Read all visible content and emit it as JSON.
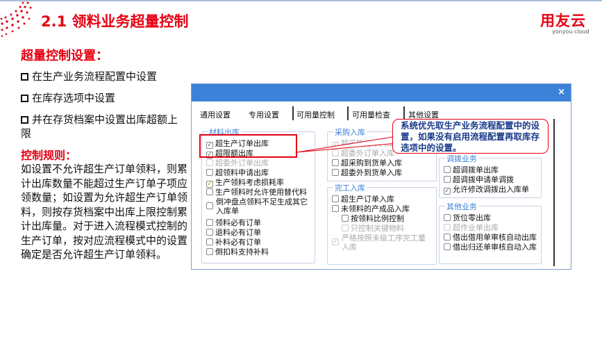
{
  "slide": {
    "title": "2.1 领料业务超量控制",
    "logo": "用友云",
    "logo_sub": "yonyou cloud",
    "accent": "#e60012",
    "setting_heading": "超量控制设置：",
    "setting_items": [
      "在生产业务流程配置中设置",
      "在库存选项中设置",
      "并在存货档案中设置出库超额上限"
    ],
    "rule_heading": "控制规则：",
    "rule_text": "如设置不允许超生产订单领料，则累计出库数量不能超过生产订单子项应领数量；如设置为允许超生产订单领料，则按存货档案中出库上限控制累计出库量。对于进入流程模式控制的生产订单，按对应流程模式中的设置确定是否允许超生产订单领料。",
    "callout": "系统优先取生产业务流程配置中的设置，如果没有启用流程配置再取库存选项中的设置。"
  },
  "dialog": {
    "close": "×",
    "tabs": [
      "通用设置",
      "专用设置",
      "可用量控制",
      "可用量检查",
      "其他设置"
    ],
    "groups": {
      "material_out": {
        "title": "材料出库",
        "items": [
          "超生产订单出库",
          "超限额出库",
          "超委外订单出库",
          "超领料申请出库",
          "生产领料考虑损耗率",
          "生产领料时允许使用替代料",
          "倒冲盘点领料不足生成其它入库单",
          "领料必有订单",
          "退料必有订单",
          "补料必有订单",
          "倒扣料支持补料"
        ]
      },
      "purchase_in": {
        "title": "采购入库",
        "items": [
          "超采购订单入库",
          "超委外订单入库",
          "超采购到货单入库",
          "超委外到货单入库"
        ]
      },
      "finish_in": {
        "title": "完工入库",
        "items": [
          "超生产订单入库",
          "未领料的产成品入库",
          "按领料比例控制",
          "只控制关键物料",
          "严格按照末级工序完工量入库"
        ]
      },
      "transfer": {
        "title": "调拨业务",
        "items": [
          "超调拨单出库",
          "超调拨申请单调拨",
          "允许修改调拨出入库单"
        ]
      },
      "other": {
        "title": "其他业务",
        "items": [
          "货位零出库",
          "超作业单出库",
          "借出借用单审核自动出库",
          "借出归还单审核自动入库"
        ]
      }
    }
  }
}
